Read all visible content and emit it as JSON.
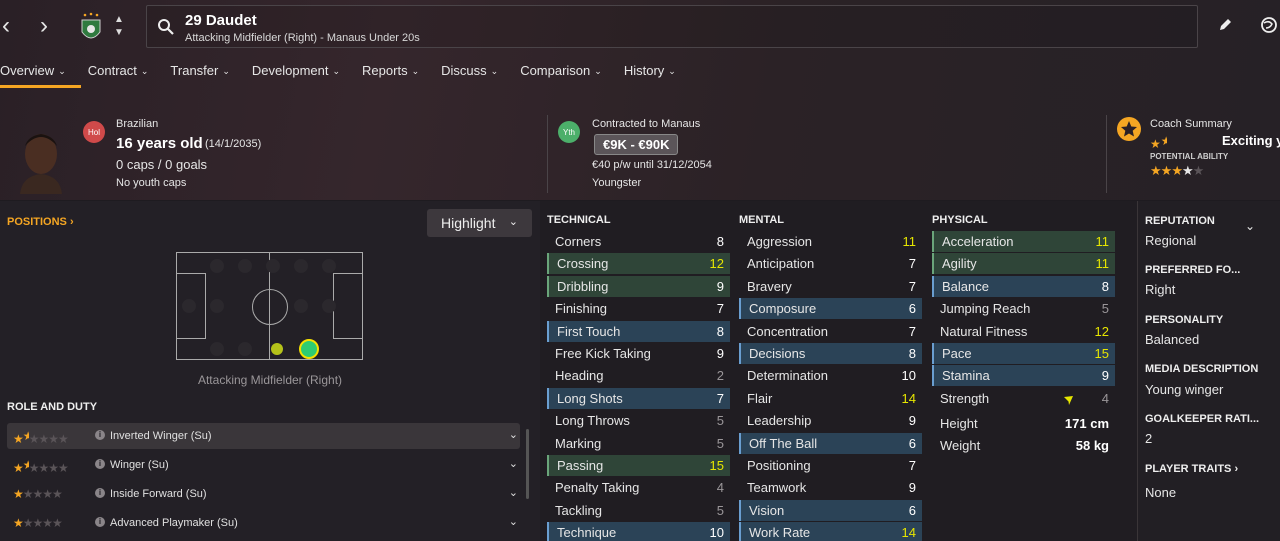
{
  "header": {
    "player_name": "29 Daudet",
    "player_role": "Attacking Midfielder (Right) - Manaus Under 20s"
  },
  "tabs": [
    {
      "label": "Overview"
    },
    {
      "label": "Contract"
    },
    {
      "label": "Transfer"
    },
    {
      "label": "Development"
    },
    {
      "label": "Reports"
    },
    {
      "label": "Discuss"
    },
    {
      "label": "Comparison"
    },
    {
      "label": "History"
    }
  ],
  "bio": {
    "nationality_badge": "Hol",
    "nationality": "Brazilian",
    "age": "16 years old",
    "dob": "(14/1/2035)",
    "caps": "0 caps / 0 goals",
    "youth_caps": "No youth caps"
  },
  "contract": {
    "badge": "Yth",
    "title": "Contracted to Manaus",
    "value": "€9K - €90K",
    "wage": "€40 p/w until 31/12/2054",
    "status": "Youngster"
  },
  "coach": {
    "title": "Coach Summary",
    "summary": "Exciting y",
    "potential_label": "POTENTIAL ABILITY",
    "current_stars": 1.5,
    "potential_stars": 3.5
  },
  "positions": {
    "title": "POSITIONS",
    "highlight_label": "Highlight",
    "position_label": "Attacking Midfielder (Right)"
  },
  "roles": {
    "title": "ROLE AND DUTY",
    "items": [
      {
        "name": "Inverted Winger (Su)",
        "stars": 1.5
      },
      {
        "name": "Winger (Su)",
        "stars": 1.5
      },
      {
        "name": "Inside Forward (Su)",
        "stars": 1
      },
      {
        "name": "Advanced Playmaker (Su)",
        "stars": 1
      }
    ]
  },
  "attributes": {
    "technical": {
      "title": "TECHNICAL",
      "items": [
        {
          "name": "Corners",
          "value": "8",
          "hl": ""
        },
        {
          "name": "Crossing",
          "value": "12",
          "hl": "g"
        },
        {
          "name": "Dribbling",
          "value": "9",
          "hl": "g"
        },
        {
          "name": "Finishing",
          "value": "7",
          "hl": ""
        },
        {
          "name": "First Touch",
          "value": "8",
          "hl": "b"
        },
        {
          "name": "Free Kick Taking",
          "value": "9",
          "hl": ""
        },
        {
          "name": "Heading",
          "value": "2",
          "hl": ""
        },
        {
          "name": "Long Shots",
          "value": "7",
          "hl": "b"
        },
        {
          "name": "Long Throws",
          "value": "5",
          "hl": ""
        },
        {
          "name": "Marking",
          "value": "5",
          "hl": ""
        },
        {
          "name": "Passing",
          "value": "15",
          "hl": "g"
        },
        {
          "name": "Penalty Taking",
          "value": "4",
          "hl": ""
        },
        {
          "name": "Tackling",
          "value": "5",
          "hl": ""
        },
        {
          "name": "Technique",
          "value": "10",
          "hl": "b"
        }
      ]
    },
    "mental": {
      "title": "MENTAL",
      "items": [
        {
          "name": "Aggression",
          "value": "11",
          "hl": ""
        },
        {
          "name": "Anticipation",
          "value": "7",
          "hl": ""
        },
        {
          "name": "Bravery",
          "value": "7",
          "hl": ""
        },
        {
          "name": "Composure",
          "value": "6",
          "hl": "b"
        },
        {
          "name": "Concentration",
          "value": "7",
          "hl": ""
        },
        {
          "name": "Decisions",
          "value": "8",
          "hl": "b"
        },
        {
          "name": "Determination",
          "value": "10",
          "hl": ""
        },
        {
          "name": "Flair",
          "value": "14",
          "hl": ""
        },
        {
          "name": "Leadership",
          "value": "9",
          "hl": ""
        },
        {
          "name": "Off The Ball",
          "value": "6",
          "hl": "b"
        },
        {
          "name": "Positioning",
          "value": "7",
          "hl": ""
        },
        {
          "name": "Teamwork",
          "value": "9",
          "hl": ""
        },
        {
          "name": "Vision",
          "value": "6",
          "hl": "b"
        },
        {
          "name": "Work Rate",
          "value": "14",
          "hl": "b"
        }
      ]
    },
    "physical": {
      "title": "PHYSICAL",
      "items": [
        {
          "name": "Acceleration",
          "value": "11",
          "hl": "g"
        },
        {
          "name": "Agility",
          "value": "11",
          "hl": "g"
        },
        {
          "name": "Balance",
          "value": "8",
          "hl": "b"
        },
        {
          "name": "Jumping Reach",
          "value": "5",
          "hl": ""
        },
        {
          "name": "Natural Fitness",
          "value": "12",
          "hl": ""
        },
        {
          "name": "Pace",
          "value": "15",
          "hl": "b"
        },
        {
          "name": "Stamina",
          "value": "9",
          "hl": "b"
        },
        {
          "name": "Strength",
          "value": "4",
          "hl": ""
        }
      ],
      "height_label": "Height",
      "height": "171 cm",
      "weight_label": "Weight",
      "weight": "58 kg"
    }
  },
  "info": {
    "reputation_title": "REPUTATION",
    "reputation": "Regional",
    "foot_title": "PREFERRED FO...",
    "foot": "Right",
    "personality_title": "PERSONALITY",
    "personality": "Balanced",
    "media_title": "MEDIA DESCRIPTION",
    "media": "Young winger",
    "gk_title": "GOALKEEPER RATI...",
    "gk": "2",
    "traits_title": "PLAYER TRAITS",
    "traits": "None"
  },
  "colors": {
    "accent": "#f5a623",
    "good": "#6aa57a",
    "key": "#6a9ed0",
    "high_value": "#e6e600"
  }
}
